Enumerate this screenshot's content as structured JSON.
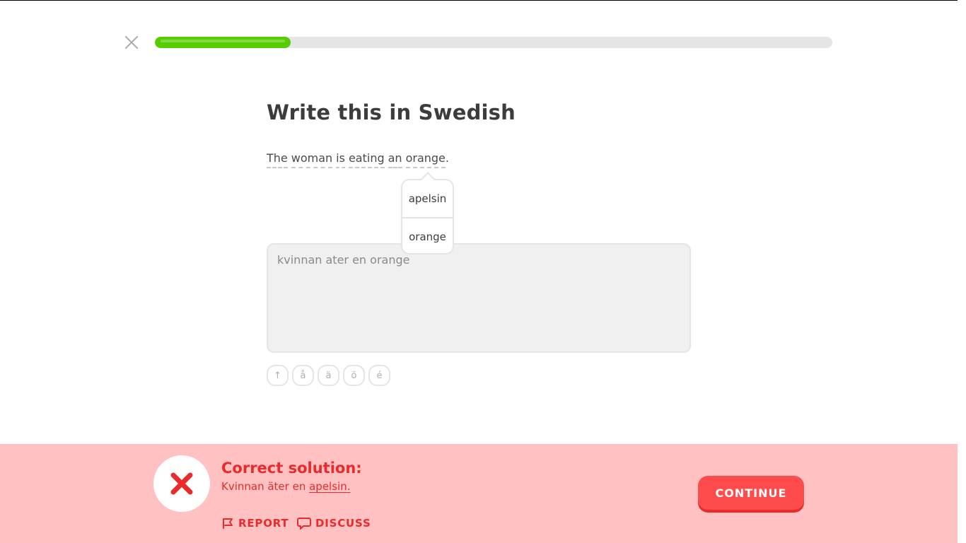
{
  "header": {
    "close_icon": "close-icon",
    "progress_fraction": 0.2
  },
  "challenge": {
    "title": "Write this in Swedish",
    "sentence_words": [
      "The",
      "woman",
      "is",
      "eating",
      "an",
      "orange"
    ],
    "sentence_end": ".",
    "hint_options": [
      "apelsin",
      "orange"
    ],
    "answer_value": "kvinnan ater en orange"
  },
  "special_chars": [
    "↑",
    "å",
    "ä",
    "ö",
    "é"
  ],
  "feedback": {
    "status_icon": "x-icon",
    "heading": "Correct solution:",
    "solution_prefix": "Kvinnan äter en ",
    "solution_highlight": "apelsin.",
    "report_label": "REPORT",
    "discuss_label": "DISCUSS",
    "continue_label": "CONTINUE"
  },
  "colors": {
    "progress": "#58cc02",
    "error": "#ea2b2b",
    "feedback_bg": "#ffc1c1",
    "continue_bg": "#ff4b4b"
  }
}
